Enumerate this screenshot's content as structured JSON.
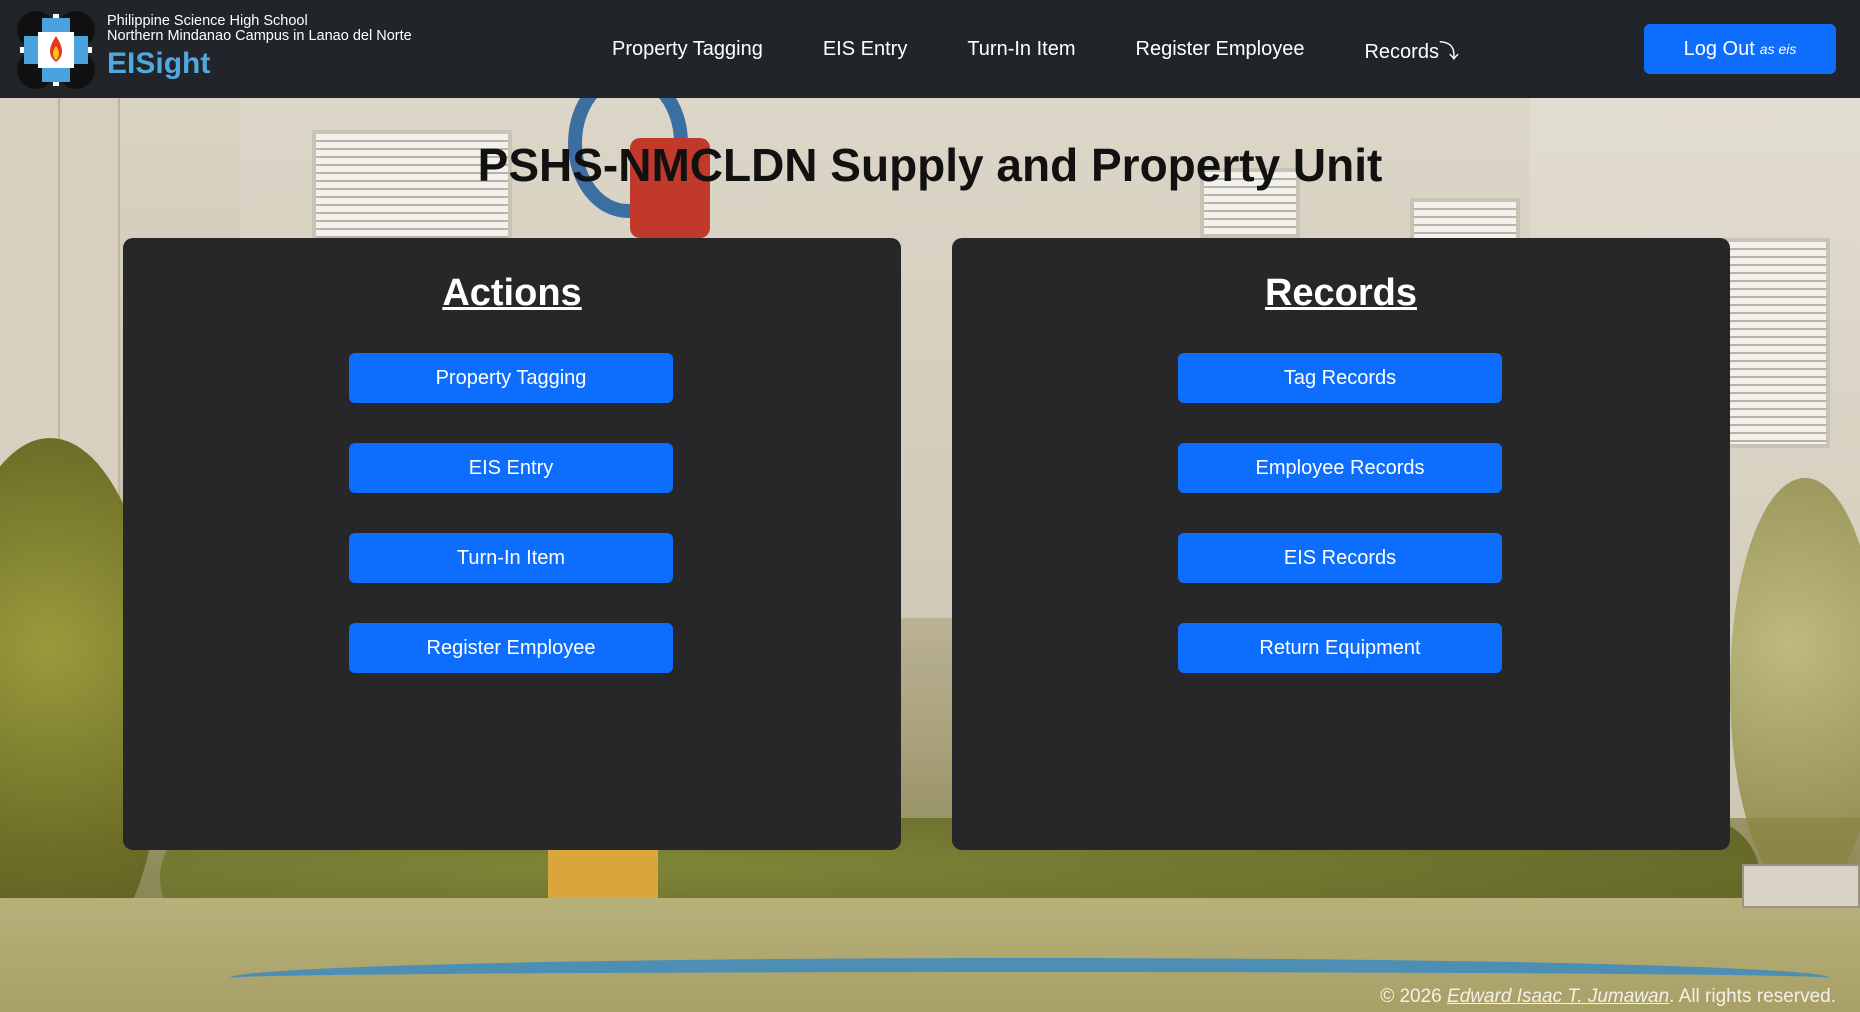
{
  "brand": {
    "school": "Philippine Science High School",
    "campus": "Northern Mindanao Campus in Lanao del Norte",
    "app_name": "EISight"
  },
  "nav": {
    "items": [
      "Property Tagging",
      "EIS Entry",
      "Turn-In Item",
      "Register Employee"
    ],
    "records_label": "Records",
    "records_arrow": "⤵"
  },
  "logout": {
    "label": "Log Out",
    "as_text": "as eis"
  },
  "page_title": "PSHS-NMCLDN Supply and Property Unit",
  "actions": {
    "heading": "Actions",
    "buttons": [
      "Property Tagging",
      "EIS Entry",
      "Turn-In Item",
      "Register Employee"
    ]
  },
  "records": {
    "heading": "Records",
    "buttons": [
      "Tag Records",
      "Employee Records",
      "EIS Records",
      "Return Equipment"
    ]
  },
  "footer": {
    "prefix": "© 2026 ",
    "author": "Edward Isaac T. Jumawan",
    "suffix": ". All rights reserved."
  },
  "colors": {
    "navbar": "#212529",
    "accent_blue": "#0d6efd",
    "brand_blue": "#4fa8e0",
    "panel": "#27272a"
  }
}
